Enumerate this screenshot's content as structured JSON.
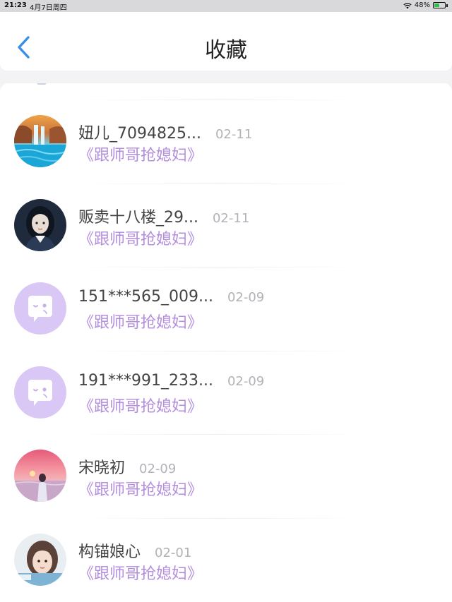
{
  "status_bar": {
    "time": "21:23",
    "date": "4月7日周四",
    "battery": "48%",
    "battery_level": 0.48,
    "icons": [
      "wifi-icon",
      "battery-charging-icon"
    ]
  },
  "nav": {
    "back_icon": "chevron-left-icon",
    "title": "收藏"
  },
  "colors": {
    "accent": "#3a8ee6",
    "book_title": "#b48ede",
    "avatar_placeholder": "#d9c8f5"
  },
  "favorites": [
    {
      "name": "妞儿_7094825...",
      "date": "02-11",
      "book": "《跟师哥抢媳妇》",
      "avatar": "waterfall-photo"
    },
    {
      "name": "贩卖十八楼_29...",
      "date": "02-11",
      "book": "《跟师哥抢媳妇》",
      "avatar": "girl-illustration"
    },
    {
      "name": "151***565_009...",
      "date": "02-09",
      "book": "《跟师哥抢媳妇》",
      "avatar": "default-chat-icon"
    },
    {
      "name": "191***991_233...",
      "date": "02-09",
      "book": "《跟师哥抢媳妇》",
      "avatar": "default-chat-icon"
    },
    {
      "name": "宋晓初",
      "date": "02-09",
      "book": "《跟师哥抢媳妇》",
      "avatar": "sunset-photo"
    },
    {
      "name": "构锚娘心",
      "date": "02-01",
      "book": "《跟师哥抢媳妇》",
      "avatar": "portrait-photo"
    }
  ]
}
